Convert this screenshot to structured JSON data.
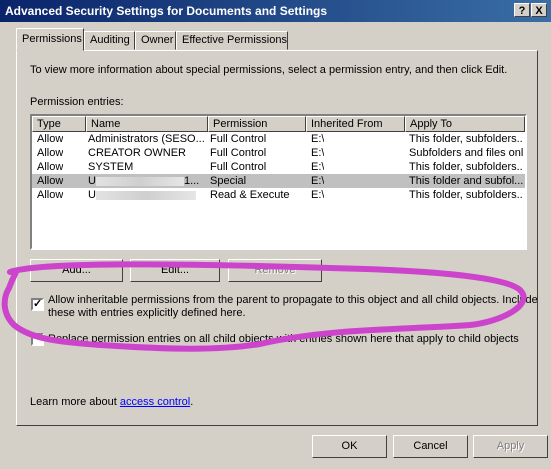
{
  "window": {
    "title": "Advanced Security Settings for Documents and Settings",
    "help_glyph": "?",
    "close_glyph": "X"
  },
  "tabs": [
    {
      "label": "Permissions",
      "active": true
    },
    {
      "label": "Auditing"
    },
    {
      "label": "Owner"
    },
    {
      "label": "Effective Permissions"
    }
  ],
  "permissions": {
    "intro": "To view more information about special permissions, select a permission entry, and then click Edit.",
    "entries_label": "Permission entries:",
    "columns": [
      "Type",
      "Name",
      "Permission",
      "Inherited From",
      "Apply To"
    ],
    "rows": [
      {
        "type": "Allow",
        "name": "Administrators (SESO...",
        "permission": "Full Control",
        "inherited": "E:\\",
        "apply": "This folder, subfolders..."
      },
      {
        "type": "Allow",
        "name": "CREATOR OWNER",
        "permission": "Full Control",
        "inherited": "E:\\",
        "apply": "Subfolders and files only"
      },
      {
        "type": "Allow",
        "name": "SYSTEM",
        "permission": "Full Control",
        "inherited": "E:\\",
        "apply": "This folder, subfolders..."
      },
      {
        "type": "Allow",
        "name": "U",
        "name_suffix": "1...",
        "permission": "Special",
        "inherited": "E:\\",
        "apply": "This folder and subfol...",
        "selected": true
      },
      {
        "type": "Allow",
        "name": "U",
        "permission": "Read & Execute",
        "inherited": "E:\\",
        "apply": "This folder, subfolders..."
      }
    ],
    "add_button": "Add...",
    "edit_button": "Edit...",
    "remove_button": "Remove",
    "inherit_checkbox": {
      "checked": true,
      "label_line1": "Allow inheritable permissions from the parent to propagate to this object and all child objects. Include",
      "label_line2": "these with entries explicitly defined here."
    },
    "replace_checkbox": {
      "checked": false,
      "label": "Replace permission entries on all child objects with entries shown here that apply to child objects"
    },
    "learn_more_prefix": "Learn more about",
    "learn_more_link": "access control",
    "learn_more_suffix": "."
  },
  "footer": {
    "ok": "OK",
    "cancel": "Cancel",
    "apply": "Apply"
  },
  "annotation": {
    "color": "#cc44cc"
  }
}
